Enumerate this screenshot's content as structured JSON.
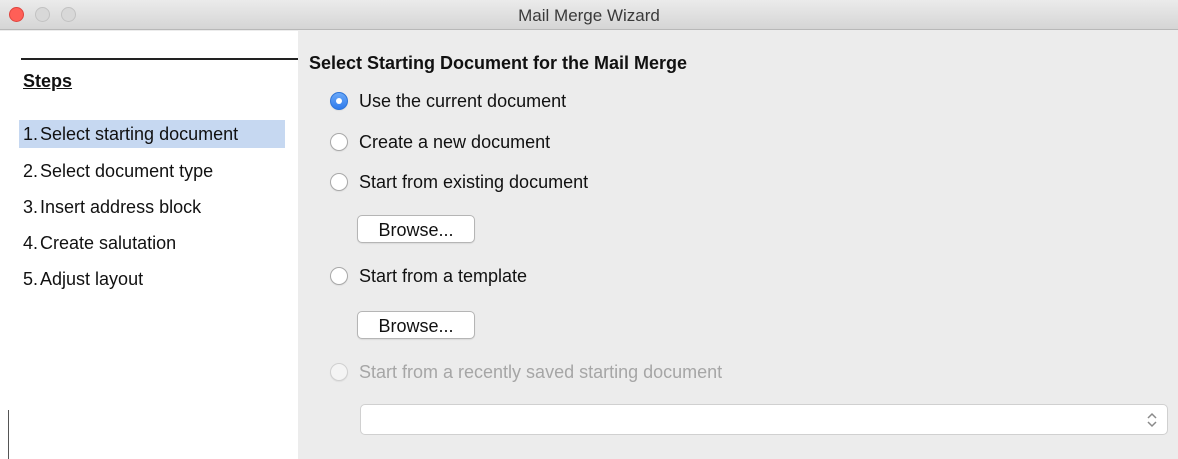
{
  "window": {
    "title": "Mail Merge Wizard"
  },
  "sidebar": {
    "heading": "Steps",
    "items": [
      {
        "num": "1.",
        "label": "Select starting document",
        "selected": true
      },
      {
        "num": "2.",
        "label": "Select document type",
        "selected": false
      },
      {
        "num": "3.",
        "label": "Insert address block",
        "selected": false
      },
      {
        "num": "4.",
        "label": "Create salutation",
        "selected": false
      },
      {
        "num": "5.",
        "label": "Adjust layout",
        "selected": false
      }
    ]
  },
  "main": {
    "title": "Select Starting Document for the Mail Merge",
    "options": [
      {
        "label": "Use the current document",
        "checked": true,
        "enabled": true
      },
      {
        "label": "Create a new document",
        "checked": false,
        "enabled": true
      },
      {
        "label": "Start from existing document",
        "checked": false,
        "enabled": true
      },
      {
        "label": "Start from a template",
        "checked": false,
        "enabled": true
      },
      {
        "label": "Start from a recently saved starting document",
        "checked": false,
        "enabled": false
      }
    ],
    "browse_existing_label": "Browse...",
    "browse_template_label": "Browse...",
    "recent_select": {
      "value": "",
      "enabled": false
    }
  },
  "colors": {
    "selection": "#c6d8f1",
    "radio_checked": "#2f7bec",
    "close_button": "#ff5f57"
  }
}
